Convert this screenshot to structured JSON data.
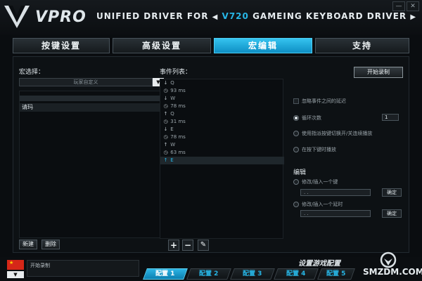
{
  "header": {
    "logo": "VPRO",
    "title_prefix": "UNIFIED DRIVER FOR",
    "model": "V720",
    "title_suffix": "GAMEING KEYBOARD DRIVER",
    "prev_arrow": "◀",
    "next_arrow": "▶",
    "minimize": "—",
    "close": "✕"
  },
  "tabs": [
    {
      "label": "按键设置",
      "active": false
    },
    {
      "label": "高级设置",
      "active": false
    },
    {
      "label": "宏编辑",
      "active": true
    },
    {
      "label": "支持",
      "active": false
    }
  ],
  "macro_panel": {
    "label": "宏选择：",
    "select_value": "玩家自定义",
    "dropdown_arrow": "▼",
    "items": [
      "请玛"
    ],
    "new_button": "新建",
    "delete_button": "删除"
  },
  "event_panel": {
    "label": "事件列表：",
    "events": [
      {
        "icon": "arrow-down-icon",
        "glyph": "↓",
        "text": "Q"
      },
      {
        "icon": "clock-icon",
        "glyph": "◷",
        "text": "93 ms"
      },
      {
        "icon": "arrow-down-icon",
        "glyph": "↓",
        "text": "W"
      },
      {
        "icon": "clock-icon",
        "glyph": "◷",
        "text": "78 ms"
      },
      {
        "icon": "arrow-up-icon",
        "glyph": "↑",
        "text": "Q"
      },
      {
        "icon": "clock-icon",
        "glyph": "◷",
        "text": "31 ms"
      },
      {
        "icon": "arrow-down-icon",
        "glyph": "↓",
        "text": "E"
      },
      {
        "icon": "clock-icon",
        "glyph": "◷",
        "text": "78 ms"
      },
      {
        "icon": "arrow-up-icon",
        "glyph": "↑",
        "text": "W"
      },
      {
        "icon": "clock-icon",
        "glyph": "◷",
        "text": "63 ms"
      },
      {
        "icon": "arrow-up-icon",
        "glyph": "↑",
        "text": "E",
        "selected": true
      }
    ],
    "add_glyph": "+",
    "remove_glyph": "−",
    "edit_glyph": "✎"
  },
  "options": {
    "record_button": "开始录制",
    "ignore_delay": "忽略事件之间的延迟",
    "loop_count_label": "循环次数",
    "loop_count_value": "1",
    "toggle_label": "使用指派按键切换开/关连续播放",
    "hold_label": "在按下键时播放",
    "edit_title": "编辑",
    "modify_key_label": "修改/插入一个键",
    "modify_key_value": ". .",
    "modify_delay_label": "修改/插入一个延时",
    "modify_delay_value": ". .",
    "confirm_label": "确定"
  },
  "bottom": {
    "status_text": "开始录制",
    "flag_dropdown": "▼",
    "caption": "设置游戏配置",
    "profiles": [
      "配置 1",
      "配置 2",
      "配置 3",
      "配置 4",
      "配置 5"
    ],
    "watermark": "SMZDM.COM"
  },
  "colors": {
    "accent": "#27b6e6",
    "active_tab": "#1aa5d8",
    "background": "#0a0d10"
  }
}
